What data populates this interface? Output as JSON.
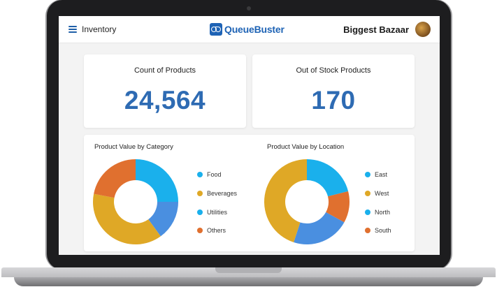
{
  "header": {
    "nav_title": "Inventory",
    "logo_text": "QueueBuster",
    "store_name": "Biggest Bazaar"
  },
  "kpis": [
    {
      "title": "Count of Products",
      "value": "24,564"
    },
    {
      "title": "Out of Stock Products",
      "value": "170"
    }
  ],
  "colors": {
    "blue": "#4a8fe0",
    "light_blue": "#1ab0ec",
    "gold": "#dfa826",
    "orange": "#e0702f",
    "accent": "#2e6bb3"
  },
  "chart_data": [
    {
      "type": "pie",
      "title": "Product Value by Category",
      "categories": [
        "Food",
        "Beverages",
        "Utilities",
        "Others"
      ],
      "values": [
        25,
        15,
        38,
        22
      ],
      "legend_colors": [
        "#1ab0ec",
        "#dfa826",
        "#1ab0ec",
        "#e0702f"
      ],
      "slice_colors": [
        "#1ab0ec",
        "#4a8fe0",
        "#dfa826",
        "#e0702f"
      ],
      "legend": "right"
    },
    {
      "type": "pie",
      "title": "Product Value by Location",
      "categories": [
        "East",
        "West",
        "North",
        "South"
      ],
      "values": [
        21,
        12,
        22,
        45
      ],
      "legend_colors": [
        "#1ab0ec",
        "#dfa826",
        "#1ab0ec",
        "#e0702f"
      ],
      "slice_colors": [
        "#1ab0ec",
        "#e0702f",
        "#4a8fe0",
        "#dfa826"
      ],
      "legend": "right"
    }
  ]
}
